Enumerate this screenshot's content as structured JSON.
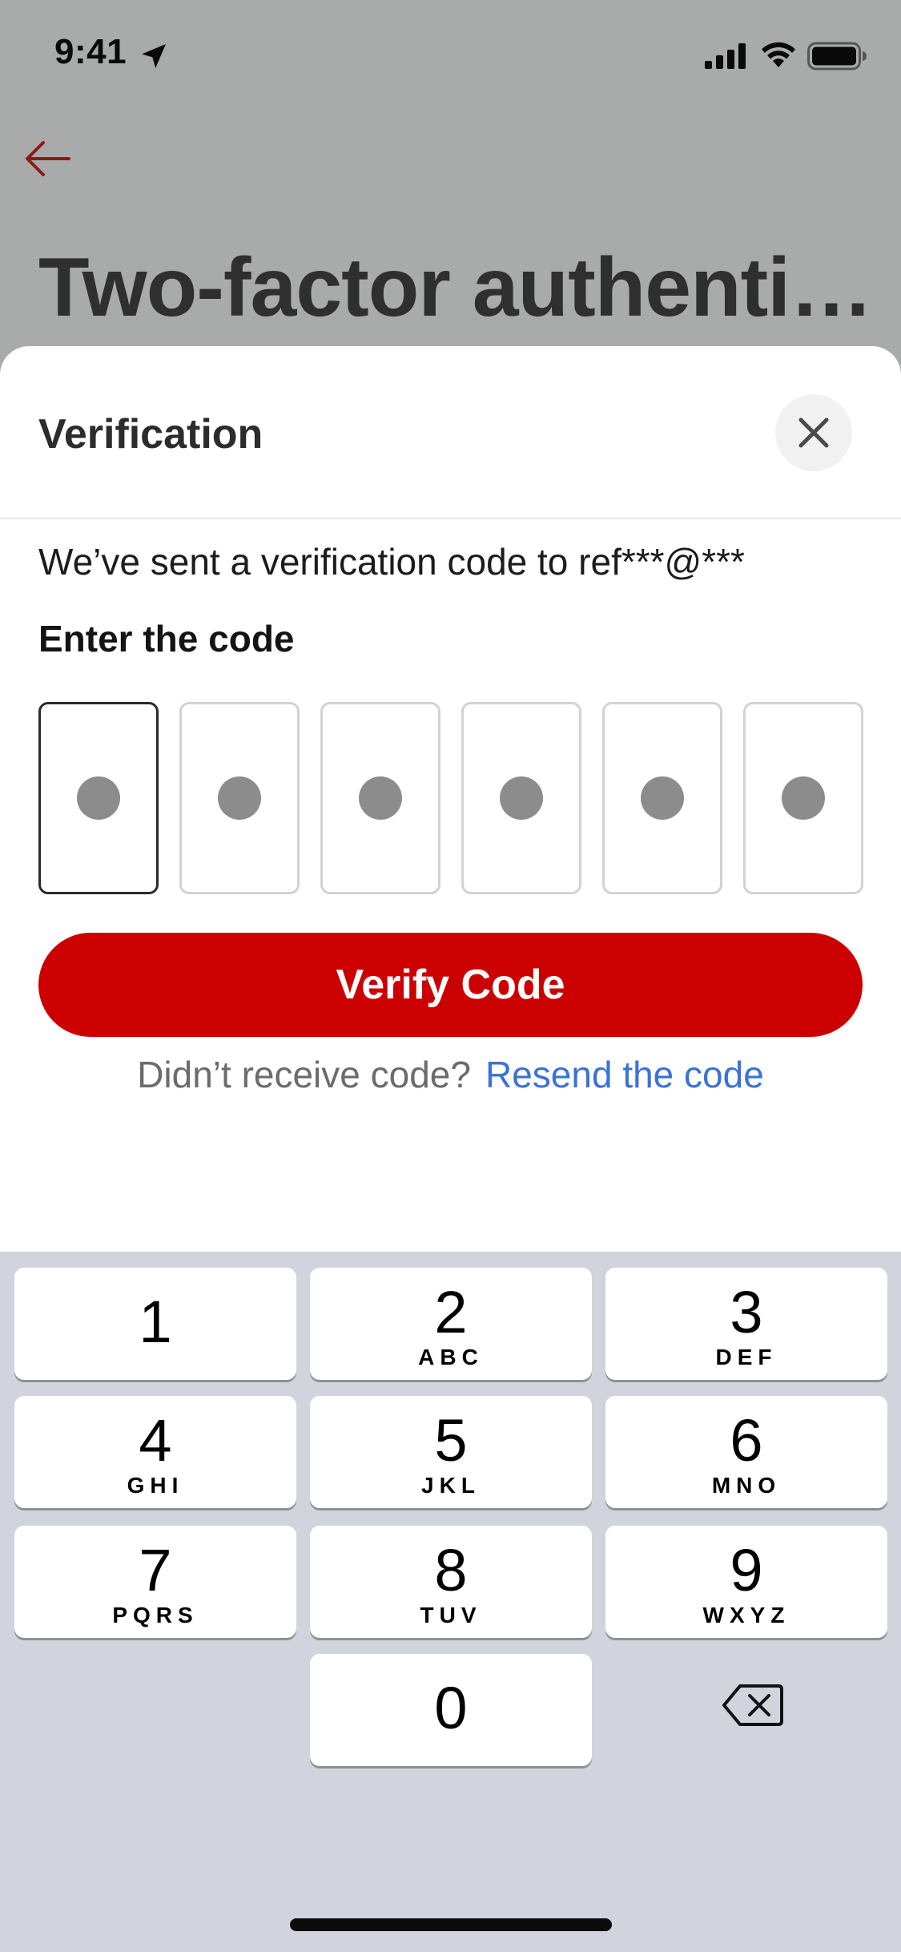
{
  "status_bar": {
    "time": "9:41",
    "icons": [
      "location-arrow-icon",
      "cellular-signal-icon",
      "wifi-icon",
      "battery-icon"
    ]
  },
  "header": {
    "back_icon": "arrow-left-icon",
    "title": "Two-factor authenti…"
  },
  "sheet": {
    "title": "Verification",
    "close_icon": "close-icon",
    "message": "We’ve sent a verification code to ref***@***",
    "code_label": "Enter the code",
    "code_digits": [
      "",
      "",
      "",
      "",
      "",
      ""
    ],
    "active_box_index": 0,
    "verify_button": "Verify Code",
    "resend_prompt": "Didn’t receive code?",
    "resend_link": "Resend the code"
  },
  "keypad": {
    "keys": [
      {
        "digit": "1",
        "letters": ""
      },
      {
        "digit": "2",
        "letters": "ABC"
      },
      {
        "digit": "3",
        "letters": "DEF"
      },
      {
        "digit": "4",
        "letters": "GHI"
      },
      {
        "digit": "5",
        "letters": "JKL"
      },
      {
        "digit": "6",
        "letters": "MNO"
      },
      {
        "digit": "7",
        "letters": "PQRS"
      },
      {
        "digit": "8",
        "letters": "TUV"
      },
      {
        "digit": "9",
        "letters": "WXYZ"
      },
      {
        "digit": "0",
        "letters": ""
      }
    ],
    "delete_icon": "backspace-icon"
  },
  "colors": {
    "accent": "#cc0000",
    "link": "#3a72d6",
    "keypad_background": "#d1d4dc",
    "overlay_background": "#a9aaaa"
  }
}
